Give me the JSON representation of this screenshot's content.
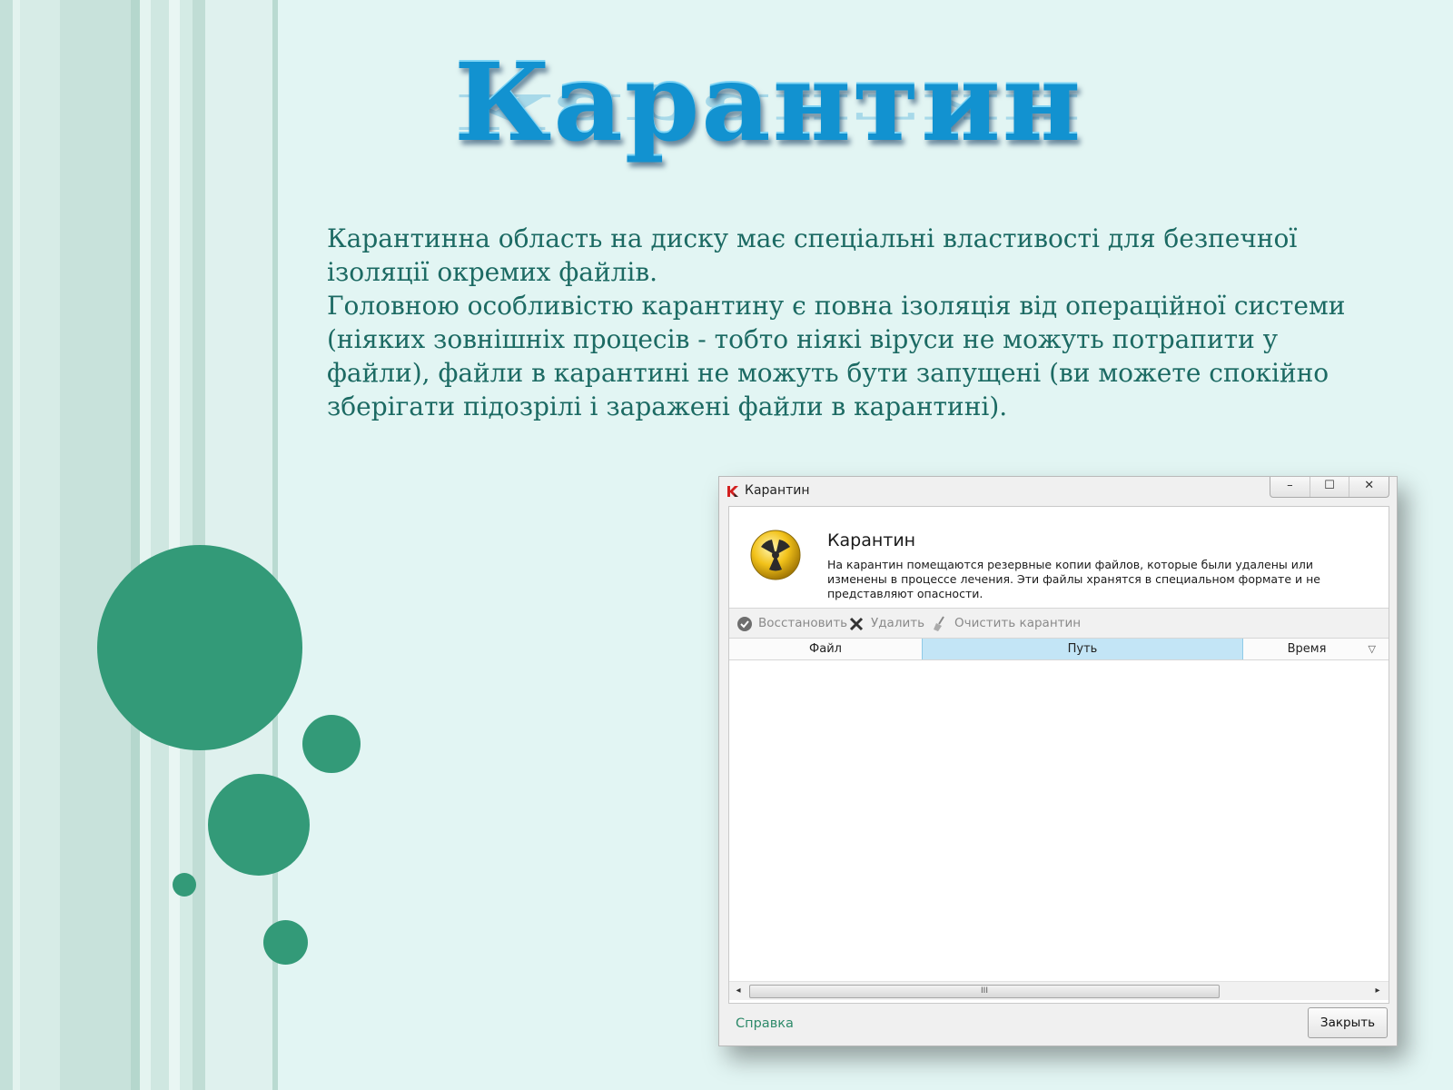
{
  "slide": {
    "title": "Карантин",
    "paragraphs": [
      "Карантинна область на диску має спеціальні властивості для безпечної ізоляції окремих файлів.",
      "Головною особливістю карантину є повна ізоляція від операційної системи (ніяких зовнішніх процесів - тобто ніякі віруси не можуть потрапити у файли), файли в карантині не можуть бути запущені (ви можете спокійно зберігати підозрілі і заражені файли в карантині)."
    ],
    "colors": {
      "background": "#e2f5f3",
      "circle": "#339a78",
      "title": "#1292d0",
      "text": "#1c6a63"
    }
  },
  "window": {
    "title": "Карантин",
    "app_icon": "kaspersky-k-icon",
    "controls": {
      "minimize": "–",
      "maximize": "☐",
      "close": "✕"
    },
    "header": {
      "icon": "radiation-icon",
      "title": "Карантин",
      "description": "На карантин помещаются резервные копии файлов, которые были удалены или изменены в процессе лечения. Эти файлы хранятся в специальном формате и не представляют опасности."
    },
    "toolbar": {
      "restore_label": "Восстановить",
      "delete_label": "Удалить",
      "clear_label": "Очистить карантин"
    },
    "table": {
      "columns": [
        "Файл",
        "Путь",
        "Время"
      ],
      "selected_column": "Путь",
      "rows": []
    },
    "scrollbar": {
      "grip": "III",
      "left": "◂",
      "right": "▸"
    },
    "footer": {
      "help_label": "Справка",
      "close_label": "Закрыть"
    }
  }
}
